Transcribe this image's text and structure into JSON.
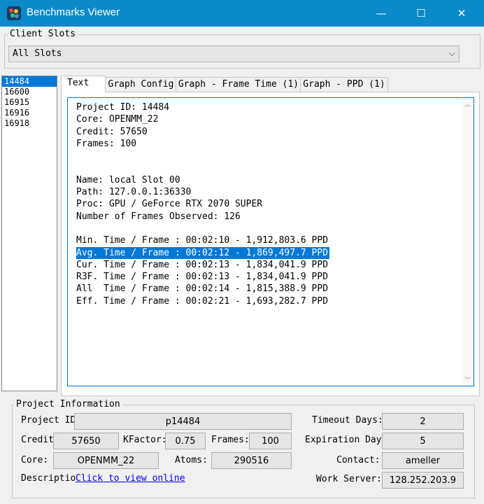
{
  "window": {
    "title": "Benchmarks Viewer",
    "minimize_glyph": "—",
    "maximize_glyph": "☐",
    "close_glyph": "✕",
    "icon": "folding-protein-icon",
    "accent": "#0a8ac9"
  },
  "client_slots": {
    "label": "Client Slots",
    "selected": "All Slots",
    "arrow_glyph": "⌵"
  },
  "projects": [
    {
      "id": "14484",
      "selected": true
    },
    {
      "id": "16600",
      "selected": false
    },
    {
      "id": "16915",
      "selected": false
    },
    {
      "id": "16916",
      "selected": false
    },
    {
      "id": "16918",
      "selected": false
    }
  ],
  "tabs": [
    {
      "label": "Text",
      "active": true
    },
    {
      "label": "Graph Config",
      "active": false
    },
    {
      "label": "Graph - Frame Time (1)",
      "active": false
    },
    {
      "label": "Graph - PPD (1)",
      "active": false
    }
  ],
  "text_lines": [
    "Project ID: 14484",
    "Core: OPENMM_22",
    "Credit: 57650",
    "Frames: 100",
    "",
    "",
    "Name: local Slot 00",
    "Path: 127.0.0.1:36330",
    "Proc: GPU / GeForce RTX 2070 SUPER",
    "Number of Frames Observed: 126",
    "",
    "Min. Time / Frame : 00:02:10 - 1,912,803.6 PPD",
    "Avg. Time / Frame : 00:02:12 - 1,869,497.7 PPD",
    "Cur. Time / Frame : 00:02:13 - 1,834,041.9 PPD",
    "R3F. Time / Frame : 00:02:13 - 1,834,041.9 PPD",
    "All  Time / Frame : 00:02:14 - 1,815,388.9 PPD",
    "Eff. Time / Frame : 00:02:21 - 1,693,282.7 PPD"
  ],
  "highlighted_line_index": 12,
  "scroll_up_glyph": "︿",
  "scroll_down_glyph": "﹀",
  "project_info": {
    "label": "Project Information",
    "project_id_label": "Project ID",
    "project_id": "p14484",
    "credit_label": "Credit",
    "credit": "57650",
    "kfactor_label": "KFactor:",
    "kfactor": "0.75",
    "frames_label": "Frames:",
    "frames": "100",
    "core_label": "Core:",
    "core": "OPENMM_22",
    "atoms_label": "Atoms:",
    "atoms": "290516",
    "description_label": "Descriptio",
    "description_link": "Click to view online",
    "timeout_label": "Timeout Days:",
    "timeout": "2",
    "expiration_label": "Expiration Days",
    "expiration": "5",
    "contact_label": "Contact:",
    "contact": "ameller",
    "work_server_label": "Work Server:",
    "work_server": "128.252.203.9"
  }
}
